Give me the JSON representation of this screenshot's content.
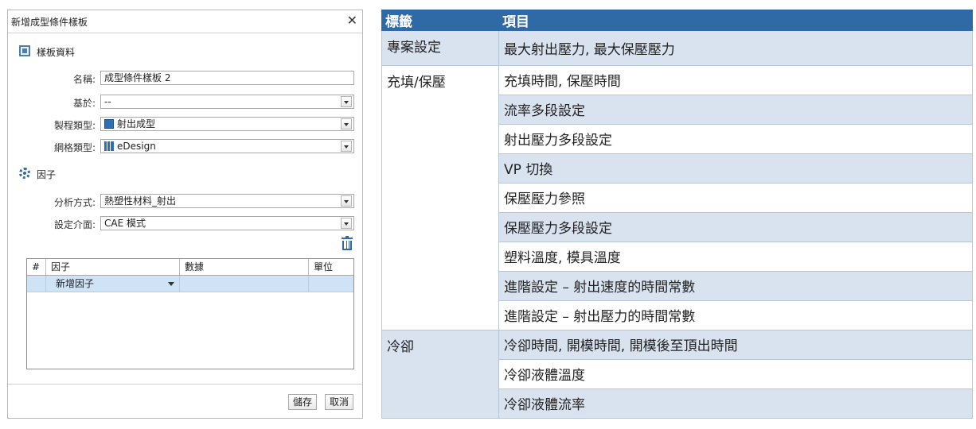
{
  "dialog": {
    "title": "新增成型條件樣板",
    "close_symbol": "✕",
    "section1": {
      "label": "樣板資料"
    },
    "fields": {
      "name": {
        "label": "名稱:",
        "value": "成型條件樣板 2"
      },
      "based_on": {
        "label": "基於:",
        "value": "--"
      },
      "process_type": {
        "label": "製程類型:",
        "value": "射出成型"
      },
      "mesh_type": {
        "label": "網格類型:",
        "value": "eDesign"
      }
    },
    "section2": {
      "label": "因子"
    },
    "analysis_method": {
      "label": "分析方式:",
      "value": "熱塑性材料_射出"
    },
    "setting_interface": {
      "label": "設定介面:",
      "value": "CAE 模式"
    },
    "grid": {
      "columns": [
        "#",
        "因子",
        "數據",
        "單位"
      ],
      "new_row_value": "新增因子"
    },
    "buttons": {
      "save": "儲存",
      "cancel": "取消"
    },
    "colors": {
      "accent": "#2f6aa6",
      "grid_row": "#cfe3f7"
    }
  },
  "table": {
    "header": {
      "tag": "標籤",
      "items": "項目"
    },
    "groups": [
      {
        "tag": "專案設定",
        "rows": [
          "最大射出壓力, 最大保壓壓力"
        ]
      },
      {
        "tag": "充填/保壓",
        "rows": [
          "充填時間, 保壓時間",
          "流率多段設定",
          "射出壓力多段設定",
          "VP 切換",
          "保壓壓力參照",
          "保壓壓力多段設定",
          "塑料溫度, 模具溫度",
          "進階設定 – 射出速度的時間常數",
          "進階設定 – 射出壓力的時間常數"
        ]
      },
      {
        "tag": "冷卻",
        "rows": [
          "冷卻時間, 開模時間, 開模後至頂出時間",
          "冷卻液體溫度",
          "冷卻液體流率"
        ]
      }
    ],
    "colors": {
      "header_bg": "#2f6aa6",
      "shade": "#d9e3ef"
    }
  }
}
